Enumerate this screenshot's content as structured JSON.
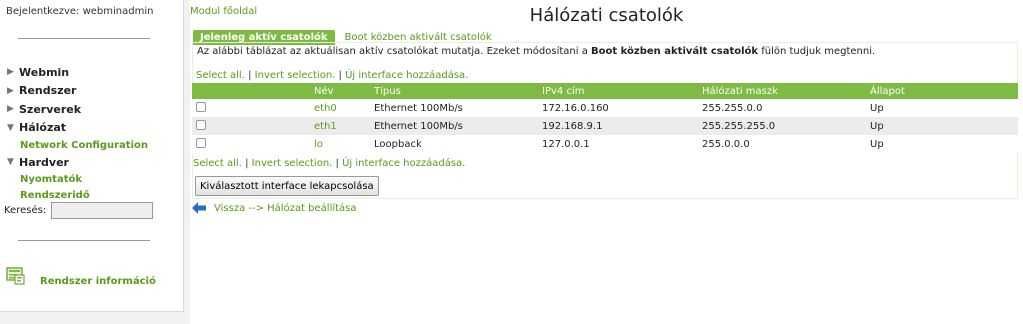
{
  "sidebar": {
    "login": "Bejelentkezve: webminadmin",
    "menu": [
      {
        "label": "Webmin",
        "expanded": false
      },
      {
        "label": "Rendszer",
        "expanded": false
      },
      {
        "label": "Szerverek",
        "expanded": false
      },
      {
        "label": "Hálózat",
        "expanded": true,
        "children": [
          "Network Configuration"
        ]
      },
      {
        "label": "Hardver",
        "expanded": true,
        "children": [
          "Nyomtatók",
          "Rendszeridő"
        ]
      }
    ],
    "search_label": "Keresés:",
    "sysinfo_label": "Rendszer információ"
  },
  "main": {
    "module_link": "Modul főoldal",
    "title": "Hálózati csatolók",
    "tabs": {
      "active": "Jelenleg aktív csatolók",
      "inactive": "Boot közben aktivált csatolók"
    },
    "desc_prefix": "Az alábbi táblázat az aktuálisan aktív csatolókat mutatja. Ezeket módosítani a ",
    "desc_bold": "Boot közben aktivált csatolók",
    "desc_suffix": " fülön tudjuk megtenni.",
    "actions": {
      "select_all": "Select all.",
      "invert": "Invert selection.",
      "new_iface": "Új interface hozzáadása.",
      "sep": "|"
    },
    "table": {
      "headers": [
        "Név",
        "Típus",
        "IPv4 cím",
        "Hálózati maszk",
        "Állapot"
      ],
      "rows": [
        {
          "name": "eth0",
          "type": "Ethernet 100Mb/s",
          "ip": "172.16.0.160",
          "mask": "255.255.0.0",
          "status": "Up"
        },
        {
          "name": "eth1",
          "type": "Ethernet 100Mb/s",
          "ip": "192.168.9.1",
          "mask": "255.255.255.0",
          "status": "Up"
        },
        {
          "name": "lo",
          "type": "Loopback",
          "ip": "127.0.0.1",
          "mask": "255.0.0.0",
          "status": "Up"
        }
      ]
    },
    "deactivate_button": "Kiválasztott interface lekapcsolása",
    "back_link": "Vissza --> Hálózat beállítása"
  },
  "colors": {
    "accent": "#7dbb42",
    "link": "#5a9a18"
  }
}
